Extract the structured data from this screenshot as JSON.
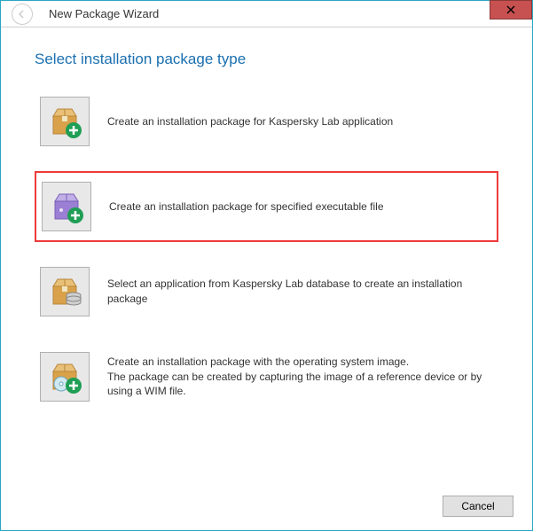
{
  "titlebar": {
    "title": "New Package Wizard"
  },
  "heading": "Select installation package type",
  "options": [
    {
      "label": "Create an installation package for Kaspersky Lab application",
      "icon": "package-add",
      "highlighted": false
    },
    {
      "label": "Create an installation package for specified executable file",
      "icon": "package-purple-add",
      "highlighted": true
    },
    {
      "label": "Select an application from Kaspersky Lab database to create an installation package",
      "icon": "package-db",
      "highlighted": false
    },
    {
      "label": "Create an installation package with the operating system image.\nThe package can be created by capturing the image of a reference device or by using a WIM file.",
      "icon": "package-disc-add",
      "highlighted": false
    }
  ],
  "footer": {
    "cancel_label": "Cancel"
  }
}
